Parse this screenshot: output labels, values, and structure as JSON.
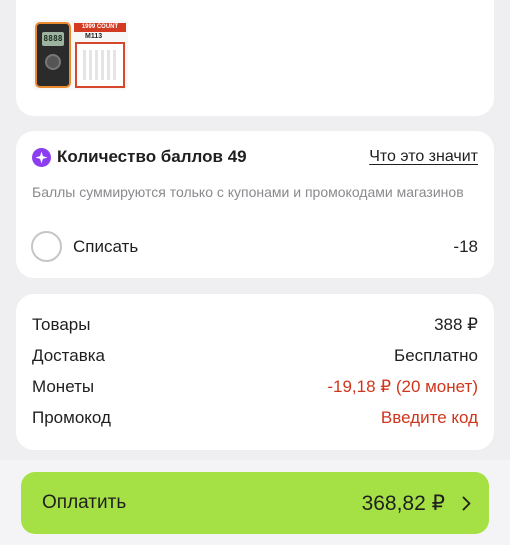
{
  "product": {
    "badge_count": "1999 COUNT",
    "badge_model": "M113",
    "screen": "8888"
  },
  "points": {
    "title": "Количество баллов 49",
    "info_link": "Что это значит",
    "description": "Баллы суммируются только с купонами и промокодами магазинов",
    "checkbox_label": "Списать",
    "amount": "-18",
    "checked": false,
    "icon_color": "#8b3ef0"
  },
  "summary": {
    "rows": [
      {
        "label": "Товары",
        "value": "388 ₽"
      },
      {
        "label": "Доставка",
        "value": "Бесплатно"
      },
      {
        "label": "Монеты",
        "value": "-19,18 ₽ (20 монет)",
        "accent": true
      },
      {
        "label": "Промокод",
        "value": "Введите код",
        "accent": true,
        "link": true
      }
    ],
    "accent_color": "#d1351b"
  },
  "pay": {
    "label": "Оплатить",
    "amount": "368,82 ₽",
    "color": "#a5e144"
  }
}
